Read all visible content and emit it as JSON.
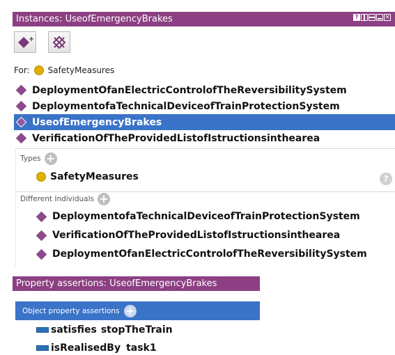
{
  "instances_panel": {
    "title": "Instances: UseofEmergencyBrakes",
    "for_label": "For:",
    "for_class": "SafetyMeasures",
    "individuals": [
      {
        "label": "DeploymentOfanElectricControlofTheReversibilitySystem",
        "selected": false
      },
      {
        "label": "DeploymentofaTechnicalDeviceofTrainProtectionSystem",
        "selected": false
      },
      {
        "label": "UseofEmergencyBrakes",
        "selected": true
      },
      {
        "label": "VerificationOfTheProvidedListofIstructionsinthearea",
        "selected": false
      }
    ]
  },
  "description": {
    "types_label": "Types",
    "types": [
      "SafetyMeasures"
    ],
    "different_label": "Different Individuals",
    "different": [
      "DeploymentofaTechnicalDeviceofTrainProtectionSystem",
      "VerificationOfTheProvidedListofIstructionsinthearea",
      "DeploymentOfanElectricControlofTheReversibilitySystem"
    ],
    "help_symbol": "?"
  },
  "property_panel": {
    "title": "Property assertions: UseofEmergencyBrakes",
    "object_label": "Object property assertions",
    "assertions": [
      {
        "property": "satisfies",
        "value": "stopTheTrain"
      },
      {
        "property": "isRealisedBy",
        "value": "task1"
      }
    ]
  },
  "colors": {
    "header": "#8c3f82",
    "selection": "#3a73c7",
    "individual": "#8c4a8a",
    "class": "#e0b000"
  }
}
